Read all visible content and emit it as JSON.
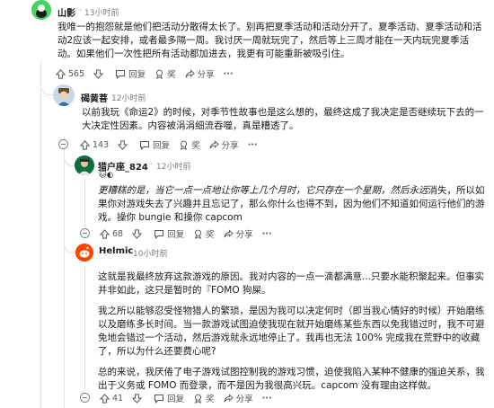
{
  "comments": [
    {
      "username": "山影",
      "time": "13小时前",
      "body": [
        "我唯一的抱怨就是他们把活动分散得太长了。别再把夏季活动和活动分开了。夏季活动、夏季活动和活动2应该一起安排，或者最多隔一周。我讨厌一周就玩完了，然后等上三周才能在一天内玩完夏季活动。如果他们一次性把所有活动都加进去，我更有可能重新被吸引住。"
      ],
      "votes": "565",
      "reply_label": "回复",
      "award_label": "奖",
      "share_label": "分享",
      "more_label": "···"
    },
    {
      "username": "碣黄菩",
      "time": "12小时前",
      "body": [
        "以前我玩《命运2》的时候，对季节性故事也是这么想的，最终这成了我决定是否继续玩下去的一大决定性因素。内容被涓涓细流吞噬，真是糟透了。"
      ],
      "votes": "143",
      "reply_label": "回复",
      "award_label": "奖",
      "share_label": "分享",
      "more_label": "···"
    },
    {
      "username": "猎户座_824",
      "time": "12小时前",
      "flair": "🐱◐",
      "body_italic": "更糟糕的是，当它一点一点地让你等上几个月时，它只存在一个星期，然后永远",
      "body_rest": "消失，所以如果你对游戏失去了兴趣并且忘记了，那么你什么也得不到，因为他们不知道如何运行他们的游戏。操你 bungie 和操你 capcom",
      "votes": "68",
      "reply_label": "回复",
      "award_label": "奖",
      "share_label": "分享",
      "more_label": "···"
    },
    {
      "username": "Helmic",
      "time": "10小时前",
      "body": [
        "这就是我最终放弃这款游戏的原因。我对内容的一点一滴都满意...只要水能积聚起来。但事实并非如此，这只是暂时的『FOMO 狗屎。",
        "我之所以能够忍受怪物猎人的繁琐，是因为我可以决定何时（即当我心情好的时候）开始磨练以及磨练多长时间。当一款游戏试图迫使我现在就开始磨练某些东西以免我错过时，我不可避免地会错过一个活动，然后游戏就永远地停止了。我再也无法 100% 完成我在荒野中的收藏了，所以为什么还要费心呢?",
        "总的来说，我厌倦了电子游戏试图控制我的游戏习惯，迫使我陷入某种不健康的强迫关系，我出于义务或 FOMO 而登录，而不是因为我很高兴玩。capcom 没有理由这样做。"
      ],
      "votes": "41",
      "reply_label": "回复",
      "award_label": "奖",
      "share_label": "分享",
      "more_label": "···"
    }
  ],
  "time_separator": "·",
  "colors": {
    "thread_line": "#e0e0e0",
    "meta_text": "#7c7c7c",
    "avatar1_bg": "#46d160",
    "avatar2_bg": "#c9d8e6",
    "avatar3_bg": "#0e6e3d",
    "avatar4_bg": "#ff4500"
  },
  "icons": [
    "upvote-icon",
    "downvote-icon",
    "comment-icon",
    "award-icon",
    "share-icon",
    "collapse-icon"
  ]
}
